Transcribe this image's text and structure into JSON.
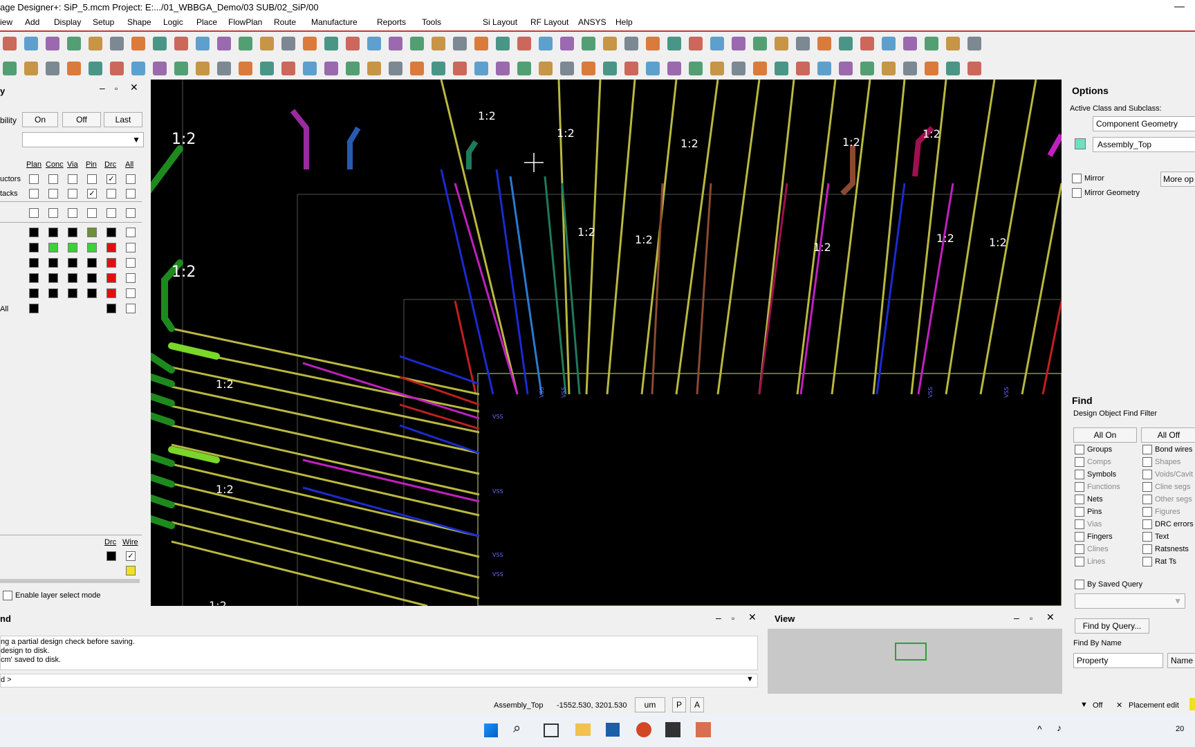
{
  "title": "age Designer+: SiP_5.mcm  Project: E:.../01_WBBGA_Demo/03 SUB/02_SiP/00",
  "menu": [
    "iew",
    "Add",
    "Display",
    "Setup",
    "Shape",
    "Logic",
    "Place",
    "FlowPlan",
    "Route",
    "Manufacture",
    "Reports",
    "Tools",
    "Si Layout",
    "RF Layout",
    "ANSYS",
    "Help"
  ],
  "visibility": {
    "title": "y",
    "label": "bility",
    "btn_on": "On",
    "btn_off": "Off",
    "btn_last": "Last",
    "cols": [
      "Plan",
      "Conc",
      "Via",
      "Pin",
      "Drc",
      "All"
    ],
    "row1": "uctors",
    "row2": "tacks",
    "row_all": "All",
    "drc_label": "Drc",
    "wire_label": "Wire",
    "enable_mode": "Enable layer select mode"
  },
  "canvas": {
    "labels": [
      "1:2",
      "1:2",
      "1:2",
      "1:2",
      "1:2",
      "1:2",
      "1:2",
      "1:2",
      "1:2",
      "1:2",
      "1:2",
      "1:2",
      "1:2",
      "1:2",
      "1:2"
    ],
    "pin_labels": [
      "VSS",
      "VSS",
      "VSS",
      "VSS",
      "VSS",
      "VSS",
      "VSS",
      "VSS"
    ]
  },
  "options": {
    "title": "Options",
    "active_label": "Active Class and Subclass:",
    "class_value": "Component Geometry",
    "subclass_value": "Assembly_Top",
    "mirror": "Mirror",
    "more_options": "More op",
    "mirror_geometry": "Mirror Geometry"
  },
  "find": {
    "title": "Find",
    "filter_label": "Design Object Find Filter",
    "all_on": "All On",
    "all_off": "All Off",
    "left_items": [
      "Groups",
      "Comps",
      "Symbols",
      "Functions",
      "Nets",
      "Pins",
      "Vias",
      "Fingers",
      "Clines",
      "Lines"
    ],
    "right_items": [
      "Bond wires",
      "Shapes",
      "Voids/Cavit",
      "Cline segs",
      "Other segs",
      "Figures",
      "DRC errors",
      "Text",
      "Ratsnests",
      "Rat Ts"
    ],
    "by_saved_query": "By Saved Query",
    "find_by_query": "Find by Query...",
    "find_by_name": "Find By Name",
    "property": "Property",
    "name": "Name"
  },
  "command": {
    "title": "nd",
    "lines": [
      "ng a partial design check before saving.",
      "design to disk.",
      "cm' saved to disk."
    ],
    "prompt": "d >"
  },
  "view": {
    "title": "View"
  },
  "status": {
    "subclass": "Assembly_Top",
    "coords": "-1552.530, 3201.530",
    "units": "um",
    "p": "P",
    "a": "A",
    "off": "Off",
    "placement_edit": "Placement edit"
  },
  "taskbar": {
    "time": "20"
  },
  "colors": {
    "accent_red": "#c0392b",
    "canvas": "#000000",
    "trace_yellow": "#b9b840",
    "trace_green": "#1e8a1e"
  }
}
